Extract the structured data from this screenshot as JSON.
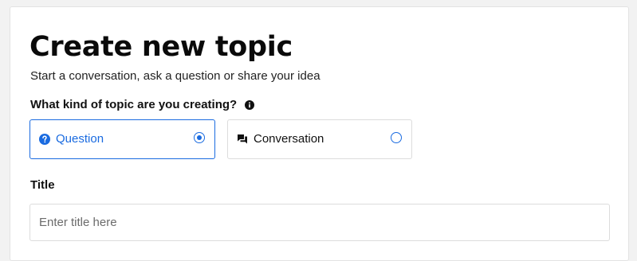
{
  "header": {
    "title": "Create new topic",
    "subtitle": "Start a conversation, ask a question or share your idea"
  },
  "topic_type": {
    "label": "What kind of topic are you creating?",
    "info_icon": "info-icon",
    "options": [
      {
        "label": "Question",
        "icon": "question-circle-icon",
        "selected": true
      },
      {
        "label": "Conversation",
        "icon": "chat-bubbles-icon",
        "selected": false
      }
    ]
  },
  "title_field": {
    "label": "Title",
    "placeholder": "Enter title here",
    "value": ""
  },
  "colors": {
    "accent": "#1a6be0",
    "border": "#dcdcdc",
    "background": "#f2f2f2"
  }
}
